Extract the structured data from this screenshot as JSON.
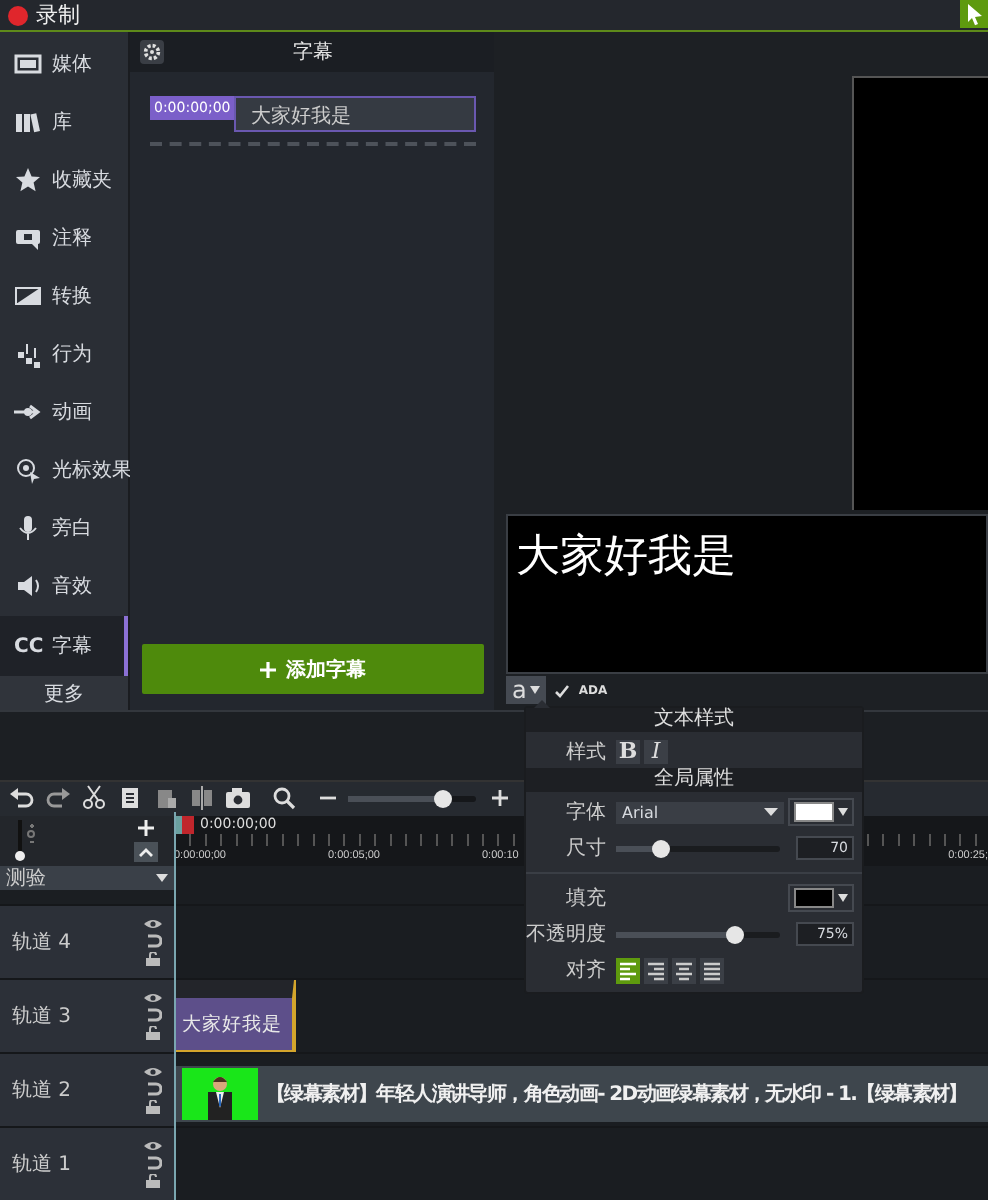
{
  "topbar": {
    "record_label": "录制"
  },
  "sidebar": {
    "items": [
      {
        "label": "媒体",
        "selected": false
      },
      {
        "label": "库",
        "selected": false
      },
      {
        "label": "收藏夹",
        "selected": false
      },
      {
        "label": "注释",
        "selected": false
      },
      {
        "label": "转换",
        "selected": false
      },
      {
        "label": "行为",
        "selected": false
      },
      {
        "label": "动画",
        "selected": false
      },
      {
        "label": "光标效果",
        "selected": false
      },
      {
        "label": "旁白",
        "selected": false
      },
      {
        "label": "音效",
        "selected": false
      },
      {
        "icon_text": "CC",
        "label": "字幕",
        "selected": true
      }
    ],
    "more": "更多"
  },
  "panel": {
    "title": "字幕",
    "captions": [
      {
        "time": "0:00:00;00",
        "text": "大家好我是",
        "selected": true
      }
    ],
    "add_button": "添加字幕"
  },
  "editor": {
    "text": "大家好我是",
    "style_button": "a",
    "ada": {
      "label": "ADA",
      "checked": true
    }
  },
  "popup": {
    "text_style": {
      "title": "文本样式",
      "label": "样式",
      "bold": "B",
      "italic": "I"
    },
    "global": {
      "title": "全局属性",
      "font": {
        "label": "字体",
        "value": "Arial",
        "color": "#ffffff"
      },
      "size": {
        "label": "尺寸",
        "level": 0.27,
        "value": "70"
      },
      "fill": {
        "label": "填充",
        "color": "#000000"
      },
      "opacity": {
        "label": "不透明度",
        "level": 0.72,
        "value": "75%"
      },
      "align": {
        "label": "对齐",
        "options": [
          {
            "kind": "left",
            "selected": true
          },
          {
            "kind": "right",
            "selected": false
          },
          {
            "kind": "center",
            "selected": false
          },
          {
            "kind": "justify",
            "selected": false
          }
        ]
      }
    }
  },
  "timeline": {
    "zoom": {
      "level": 0.74
    },
    "playhead_time": "0:00:00;00",
    "ruler_labels": [
      "0:00:00;00",
      "0:00:05;00",
      "0:00:10",
      "0:00:25;"
    ],
    "group": "测验",
    "tracks": [
      {
        "name": "轨道 4"
      },
      {
        "name": "轨道 3",
        "clips": [
          {
            "kind": "caption",
            "text": "大家好我是",
            "selected": true
          }
        ]
      },
      {
        "name": "轨道 2",
        "clips": [
          {
            "kind": "media",
            "text": "【绿幕素材】年轻人演讲导师，角色动画- 2D动画绿幕素材，无水印 - 1.【绿幕素材】",
            "selected": false
          }
        ]
      },
      {
        "name": "轨道 1"
      }
    ]
  }
}
